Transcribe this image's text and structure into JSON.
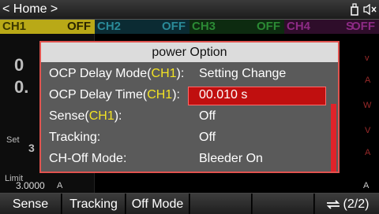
{
  "topbar": {
    "home_label": "< Home >",
    "icons": [
      "usb-icon",
      "speaker-mute-icon"
    ]
  },
  "channels": [
    {
      "name": "CH1",
      "state": "OFF",
      "color": "#b9a917"
    },
    {
      "name": "CH2",
      "state": "OFF",
      "color": "#2a8a98"
    },
    {
      "name": "CH3",
      "state": "OFF",
      "color": "#2b8a34"
    },
    {
      "name": "CH4",
      "state": "S",
      "state2": "OFF",
      "color": "#8d2a85"
    }
  ],
  "background": {
    "ch1_digit_1": "0",
    "ch1_digit_2": "0.",
    "set_label": "Set",
    "set_digit": "3",
    "limit_label": "Limit",
    "limit_value": "3.0000",
    "limit_unit": "A",
    "right_units": [
      "v",
      "A",
      "W",
      "V",
      "A"
    ],
    "right_limit_unit": "A"
  },
  "dialog": {
    "title": "power Option",
    "rows": [
      {
        "label": "OCP Delay Mode(",
        "ch": "CH1",
        "suffix": "):",
        "value": "Setting Change"
      },
      {
        "label": "OCP Delay Time(",
        "ch": "CH1",
        "suffix": "):",
        "value": "00.010 s",
        "selected": true
      },
      {
        "label": "Sense(",
        "ch": "CH1",
        "suffix": "):",
        "value": "Off"
      },
      {
        "label": "Tracking:",
        "ch": "",
        "suffix": "",
        "value": "Off"
      },
      {
        "label": "CH-Off Mode:",
        "ch": "",
        "suffix": "",
        "value": "Bleeder On"
      }
    ]
  },
  "softkeys": {
    "k1": "Sense",
    "k2": "Tracking",
    "k3": "Off Mode",
    "k4": "",
    "k5": "",
    "page": "(2/2)"
  },
  "colors": {
    "dialog_border": "#e0534f",
    "selected_bg": "#c00f0f",
    "channel_highlight": "#f3e323"
  }
}
